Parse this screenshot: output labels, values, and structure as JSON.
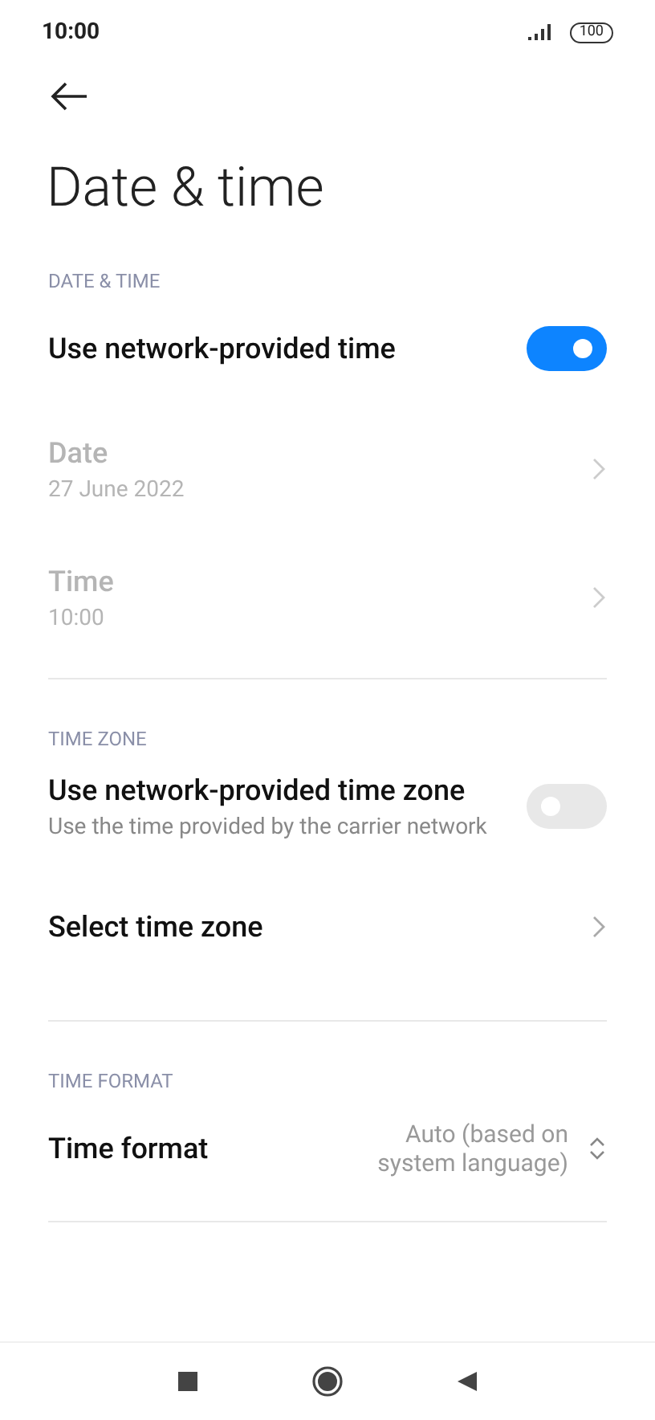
{
  "status_bar": {
    "time": "10:00",
    "battery": "100"
  },
  "title": "Date & time",
  "sections": [
    {
      "header": "DATE & TIME",
      "items": [
        {
          "kind": "toggle",
          "title": "Use network-provided time",
          "on": true,
          "disabled": false
        },
        {
          "kind": "link",
          "title": "Date",
          "summary": "27 June 2022",
          "disabled": true
        },
        {
          "kind": "link",
          "title": "Time",
          "summary": "10:00",
          "disabled": true
        }
      ]
    },
    {
      "header": "TIME ZONE",
      "items": [
        {
          "kind": "toggle",
          "title": "Use network-provided time zone",
          "summary": "Use the time provided by the carrier network",
          "on": false,
          "disabled": false
        },
        {
          "kind": "link",
          "title": "Select time zone",
          "disabled": false
        }
      ]
    },
    {
      "header": "TIME FORMAT",
      "items": [
        {
          "kind": "dropdown",
          "title": "Time format",
          "value": "Auto (based on system language)",
          "disabled": false
        }
      ]
    }
  ]
}
